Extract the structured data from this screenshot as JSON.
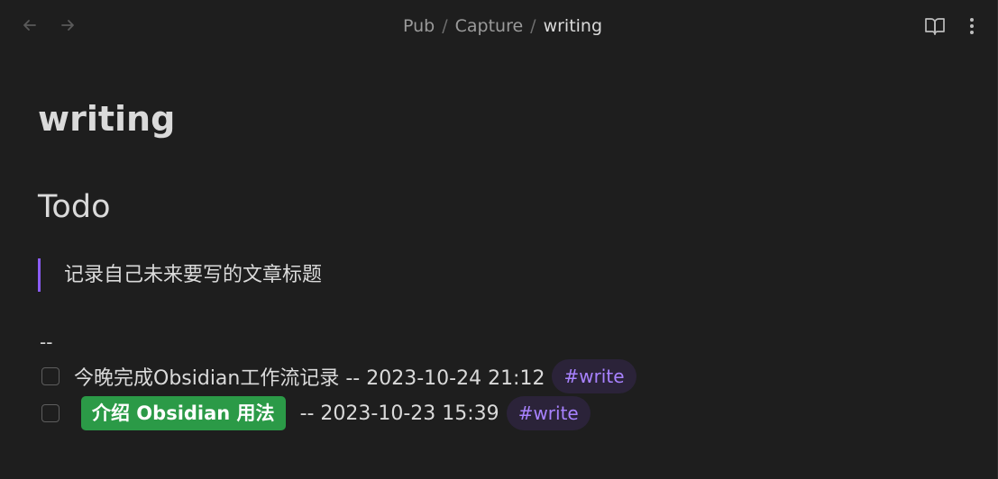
{
  "header": {
    "breadcrumb": [
      "Pub",
      "Capture",
      "writing"
    ],
    "separator": "/",
    "icons": {
      "back": "arrow-left-icon",
      "forward": "arrow-right-icon",
      "reading_view": "book-open-icon",
      "more": "more-vertical-icon"
    }
  },
  "note": {
    "title": "writing",
    "heading": "Todo",
    "blockquote": "记录自己未来要写的文章标题",
    "separator_text": "--",
    "tasks": [
      {
        "checked": false,
        "text": "今晚完成Obsidian工作流记录 -- 2023-10-24 21:12",
        "tag": "#write"
      },
      {
        "checked": false,
        "highlight": "介绍 Obsidian 用法",
        "text": "-- 2023-10-23 15:39",
        "tag": "#write"
      }
    ]
  },
  "colors": {
    "background": "#1e1e1e",
    "accent": "#8a5cf5",
    "tag_text": "#a882ff",
    "tag_bg": "#2b2339",
    "highlight_bg": "#2b9a47"
  }
}
